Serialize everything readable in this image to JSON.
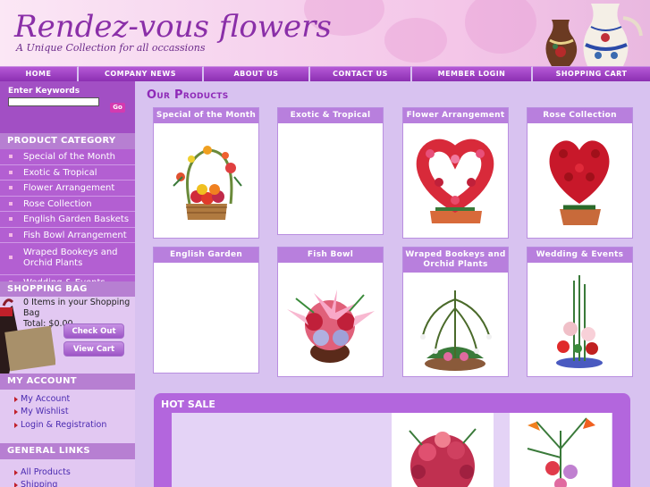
{
  "header": {
    "title": "Rendez-vous flowers",
    "subtitle": "A Unique Collection for all occassions"
  },
  "nav": [
    {
      "label": "HOME"
    },
    {
      "label": "COMPANY NEWS"
    },
    {
      "label": "ABOUT US"
    },
    {
      "label": "CONTACT US"
    },
    {
      "label": "MEMBER LOGIN"
    },
    {
      "label": "SHOPPING CART"
    }
  ],
  "search": {
    "label": "Enter Keywords",
    "value": "",
    "go_label": "Go"
  },
  "product_category": {
    "heading": "PRODUCT CATEGORY",
    "items": [
      "Special of the Month",
      "Exotic & Tropical",
      "Flower Arrangement",
      "Rose Collection",
      "English Garden Baskets",
      "Fish Bowl Arrangement",
      "Wraped Bookeys and Orchid Plants",
      "Wedding & Events"
    ]
  },
  "shopping_bag": {
    "heading": "SHOPPING BAG",
    "items_text": "0 Items in your Shopping Bag",
    "total_text": "Total: $0.00",
    "checkout_label": "Check Out",
    "view_cart_label": "View Cart"
  },
  "my_account": {
    "heading": "MY ACCOUNT",
    "links": [
      "My Account",
      "My Wishlist",
      "Login & Registration"
    ]
  },
  "general_links": {
    "heading": "GENERAL LINKS",
    "links": [
      "All Products",
      "Shipping"
    ]
  },
  "main": {
    "title": "Our Products",
    "products": [
      {
        "name": "Special of the Month",
        "icon": "flower-basket-icon"
      },
      {
        "name": "Exotic & Tropical",
        "icon": ""
      },
      {
        "name": "Flower Arrangement",
        "icon": "heart-flower-arrangement-icon"
      },
      {
        "name": "Rose Collection",
        "icon": "rose-heart-icon"
      },
      {
        "name": "English Garden Baskets",
        "icon": ""
      },
      {
        "name": "Fish Bowl Arrangement",
        "icon": "lily-bowl-icon"
      },
      {
        "name": "Wraped Bookeys and Orchid Plants",
        "icon": "orchid-plant-icon"
      },
      {
        "name": "Wedding & Events",
        "icon": "wedding-arrangement-icon"
      }
    ]
  },
  "hot_sale": {
    "title": "HOT SALE"
  },
  "colors": {
    "background": "#d8c2f0",
    "nav": "#9b3cc0",
    "accent": "#b87fdd",
    "title": "#8f2ab8"
  }
}
